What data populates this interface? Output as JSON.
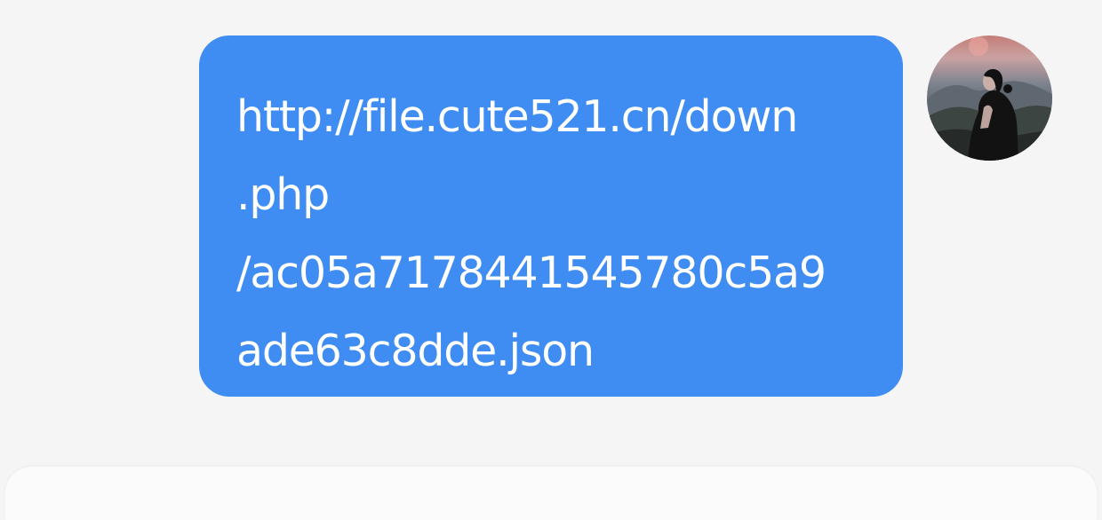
{
  "conversation": {
    "messages": [
      {
        "sender": "self",
        "avatar_icon": "user-avatar-photo-icon",
        "bubble_color": "#3f8cf2",
        "text_lines": [
          "http://file.cute521.cn/down",
          ".php",
          "/ac05a7178441545780c5a9",
          "ade63c8dde.json"
        ]
      }
    ]
  },
  "colors": {
    "background": "#f5f5f5",
    "bubble": "#3f8cf2",
    "bubble_text": "#ffffff",
    "input_panel": "#fbfbfb"
  }
}
